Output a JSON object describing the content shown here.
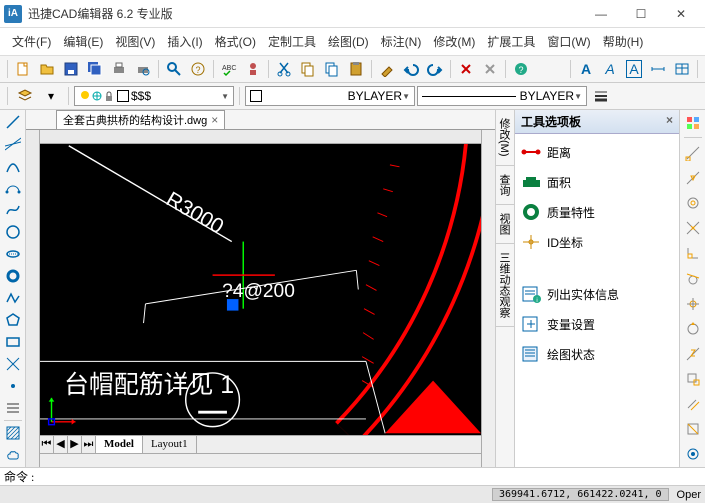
{
  "title": "迅捷CAD编辑器 6.2 专业版",
  "menu": [
    "文件(F)",
    "编辑(E)",
    "视图(V)",
    "插入(I)",
    "格式(O)",
    "定制工具",
    "绘图(D)",
    "标注(N)",
    "修改(M)",
    "扩展工具",
    "窗口(W)",
    "帮助(H)"
  ],
  "doc_tab": {
    "name": "全套古典拱桥的结构设计.dwg"
  },
  "layer_combo1": {
    "value": "$$$"
  },
  "layer_combo2": {
    "value": "BYLAYER"
  },
  "layer_combo3": {
    "value": "BYLAYER"
  },
  "layout_tabs": [
    "Model",
    "Layout1"
  ],
  "active_layout": 0,
  "palette_title": "工具选项板",
  "palette_items": [
    {
      "icon": "distance",
      "label": "距离"
    },
    {
      "icon": "area",
      "label": "面积"
    },
    {
      "icon": "massprop",
      "label": "质量特性"
    },
    {
      "icon": "idpoint",
      "label": "ID坐标"
    },
    {
      "icon": "list",
      "label": "列出实体信息"
    },
    {
      "icon": "setvar",
      "label": "变量设置"
    },
    {
      "icon": "status",
      "label": "绘图状态"
    }
  ],
  "vtabs": [
    "修改(M)",
    "查询",
    "视图",
    "三维动态观察"
  ],
  "cmd_prompt": "命令 :",
  "status_coords": "369941.6712, 661422.0241, 0",
  "status_right": "Oper",
  "canvas": {
    "r_label": "R3000",
    "dim_label": "?4@200",
    "main_label": "台帽配筋详见 1"
  },
  "text_style": {
    "labels": [
      "A",
      "A",
      "A"
    ]
  }
}
